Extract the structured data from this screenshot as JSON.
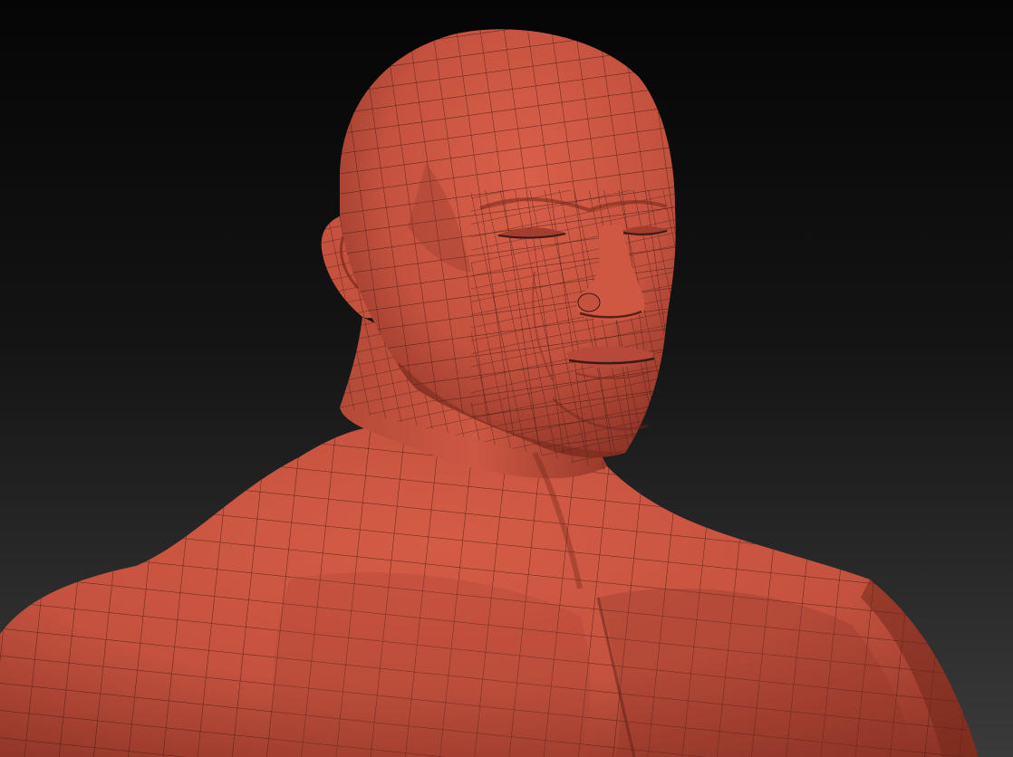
{
  "scene": {
    "subject": "bust-mesh",
    "colors": {
      "background_top": "#050505",
      "background_bottom": "#3a3a3a",
      "skin_light": "#d9604a",
      "skin_base": "#c4523f",
      "skin_shadow": "#8f3527",
      "skin_deep": "#6e2518",
      "wire": "#3a1a14"
    }
  }
}
